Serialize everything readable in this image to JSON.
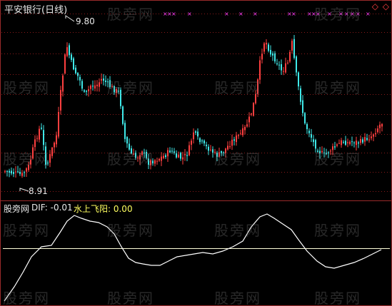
{
  "title": "平安银行(日线)",
  "corner_icons": "◇ ◇",
  "price_high": "9.80",
  "price_low": "8.91",
  "indicator": {
    "name": "股旁网",
    "dif_label": "DIF: -0.01",
    "line_label": "水上飞阳: 0.00"
  },
  "watermark": "股旁网",
  "colors": {
    "background": "#000000",
    "up": "#ff3f3f",
    "down": "#3fe8e8",
    "grid": "#8a1a1a",
    "signal": "#ff3fff",
    "dif_line": "#ffffff",
    "zero_line": "#ffffdc"
  }
}
